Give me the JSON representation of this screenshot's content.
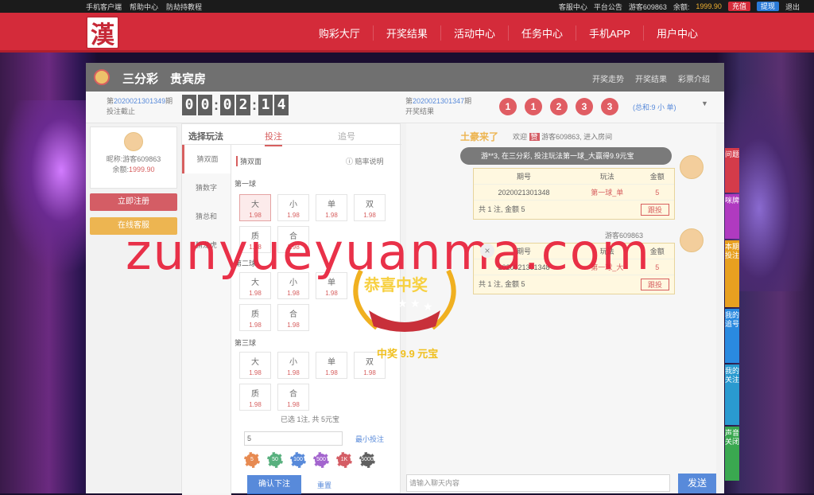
{
  "topbar": {
    "client": "手机客户端",
    "help": "帮助中心",
    "anti_hijack": "防劫持教程",
    "service": "客服中心",
    "notice": "平台公告",
    "user": "游客609863",
    "balance_label": "余额:",
    "balance": "1999.90",
    "recharge": "充值",
    "withdraw": "提现",
    "logout": "退出"
  },
  "logo_char": "漢",
  "nav": [
    "购彩大厅",
    "开奖结果",
    "活动中心",
    "任务中心",
    "手机APP",
    "用户中心"
  ],
  "panel": {
    "game": "三分彩",
    "room": "贵宾房",
    "links": [
      "开奖走势",
      "开奖结果",
      "彩票介绍"
    ]
  },
  "issue": {
    "current_prefix": "第",
    "current": "2020021301349",
    "current_suffix": "期",
    "status": "投注截止",
    "clock": [
      "0",
      "0",
      "0",
      "2",
      "1",
      "4"
    ],
    "last_prefix": "第",
    "last": "2020021301347",
    "last_suffix": "期",
    "last_label": "开奖结果",
    "balls": [
      "1",
      "1",
      "2",
      "3",
      "3"
    ],
    "summary": "(总和:9 小 单)"
  },
  "user": {
    "nick_label": "昵称:",
    "nick": "游客609863",
    "bal_label": "余额:",
    "bal": "1999.90",
    "register": "立即注册",
    "service": "在线客服"
  },
  "play": {
    "tab_choose": "选择玩法",
    "tab_bet": "投注",
    "tab_chase": "追号",
    "types": [
      "猜双面",
      "猜数字",
      "猜总和",
      "猜龙虎"
    ],
    "sub": "猜双面",
    "odds_help": "赔率说明",
    "ball1": "第一球",
    "ball2": "第二球",
    "ball3": "第三球",
    "row1": [
      {
        "n": "大",
        "o": "1.98"
      },
      {
        "n": "小",
        "o": "1.98"
      },
      {
        "n": "单",
        "o": "1.98"
      },
      {
        "n": "双",
        "o": "1.98"
      }
    ],
    "row2": [
      {
        "n": "质",
        "o": "1.98"
      },
      {
        "n": "合",
        "o": "1.98"
      }
    ],
    "selected": "已选 1注, 共 5元宝",
    "amount": "5",
    "min_bet": "最小投注",
    "chips": [
      "5",
      "50",
      "100",
      "500",
      "1K",
      "5000"
    ],
    "confirm": "确认下注",
    "reset": "重置"
  },
  "chat": {
    "vip": "土豪来了",
    "welcome": "欢迎",
    "tag": "赞",
    "join": "游客609863, 进入房间",
    "toast": "游**3, 在三分彩, 投注玩法第一球_大赢得9.9元宝",
    "th": [
      "期号",
      "玩法",
      "金额"
    ],
    "rows": [
      {
        "no": "2020021301348",
        "play": "第一球_单",
        "amt": "5"
      },
      {
        "no": "2020021301348",
        "play": "第一球_大",
        "amt": "5"
      }
    ],
    "total": "共 1 注, 金额 5",
    "follow": "跟投",
    "user2": "游客609863",
    "placeholder": "请输入聊天内容",
    "send": "发送"
  },
  "win": {
    "title": "恭喜中奖",
    "amount": "中奖 9.9 元宝"
  },
  "watermark": "zunyueyuanma.com",
  "side": [
    "问题",
    "咪牌",
    "本期投注",
    "我的追号",
    "我的关注",
    "声音关闭"
  ]
}
